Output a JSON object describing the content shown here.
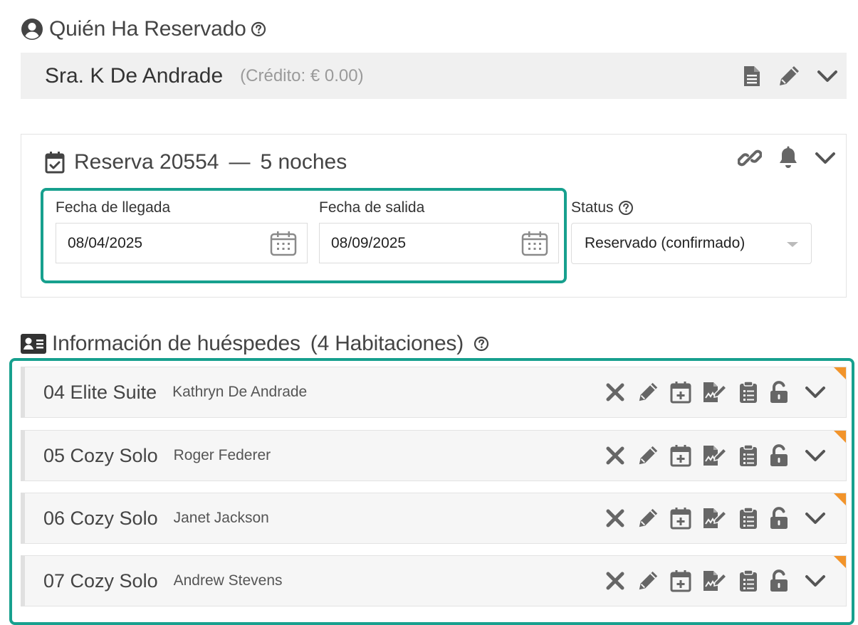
{
  "who": {
    "title": "Quién Ha Reservado",
    "guest_name": "Sra. K De Andrade",
    "credit": "(Crédito: € 0.00)"
  },
  "reservation": {
    "label": "Reserva 20554",
    "separator": "—",
    "nights": "5 noches",
    "arrival_label": "Fecha de llegada",
    "arrival_value": "08/04/2025",
    "departure_label": "Fecha de salida",
    "departure_value": "08/09/2025",
    "status_label": "Status",
    "status_value": "Reservado (confirmado)"
  },
  "guests": {
    "title": "Información de huéspedes",
    "count": "(4 Habitaciones)",
    "rooms": [
      {
        "room": "04 Elite Suite",
        "guest": "Kathryn De Andrade"
      },
      {
        "room": "05 Cozy Solo",
        "guest": "Roger Federer"
      },
      {
        "room": "06 Cozy Solo",
        "guest": "Janet Jackson"
      },
      {
        "room": "07 Cozy Solo",
        "guest": "Andrew Stevens"
      }
    ]
  },
  "colors": {
    "accent": "#17a08e",
    "corner_flag": "#f2942b",
    "icon_gray": "#666666"
  },
  "icons": [
    "user-circle-icon",
    "question-circle-icon",
    "document-icon",
    "pencil-icon",
    "chevron-down-icon",
    "calendar-check-icon",
    "link-icon",
    "bell-icon",
    "calendar-icon",
    "id-card-icon",
    "close-icon",
    "calendar-plus-icon",
    "signature-icon",
    "clipboard-list-icon",
    "unlock-icon"
  ]
}
